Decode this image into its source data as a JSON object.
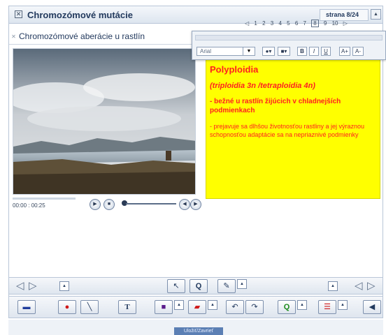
{
  "window": {
    "title": "Chromozómové mutácie",
    "page_label": "strana 8/24",
    "subtitle": "Chromozómové aberácie u rastlín"
  },
  "page_nav": {
    "pages": [
      "1",
      "2",
      "3",
      "4",
      "5",
      "6",
      "7",
      "8",
      "9",
      "10"
    ],
    "current": "8"
  },
  "video": {
    "time": "00:00 : 00:25"
  },
  "format_toolbar": {
    "font": "Arial",
    "bold": "B",
    "italic": "I",
    "underline": "U",
    "grow": "A+",
    "shrink": "A-"
  },
  "note": {
    "title": "Polyploidia",
    "subtitle": "(triploidia 3n /tetraploidia 4n)",
    "line1": "- bežné u rastlín žijúcich  v chladnejších podmienkach",
    "line2": "- prejavuje sa dlhšou životnosťou rastliny a jej výraznou schopnosťou adaptácie sa na nepriaznivé podmienky"
  },
  "toolbar1": {
    "tools": [
      "pointer-icon",
      "zoom-icon",
      "highlighter-icon"
    ]
  },
  "toolbar2": {
    "text_tool": "T"
  },
  "bottom": {
    "button": "Uložiť/Zavrieť"
  },
  "colors": {
    "note_bg": "#ffff00",
    "note_text": "#ff2020",
    "title_text": "#233a5e"
  }
}
